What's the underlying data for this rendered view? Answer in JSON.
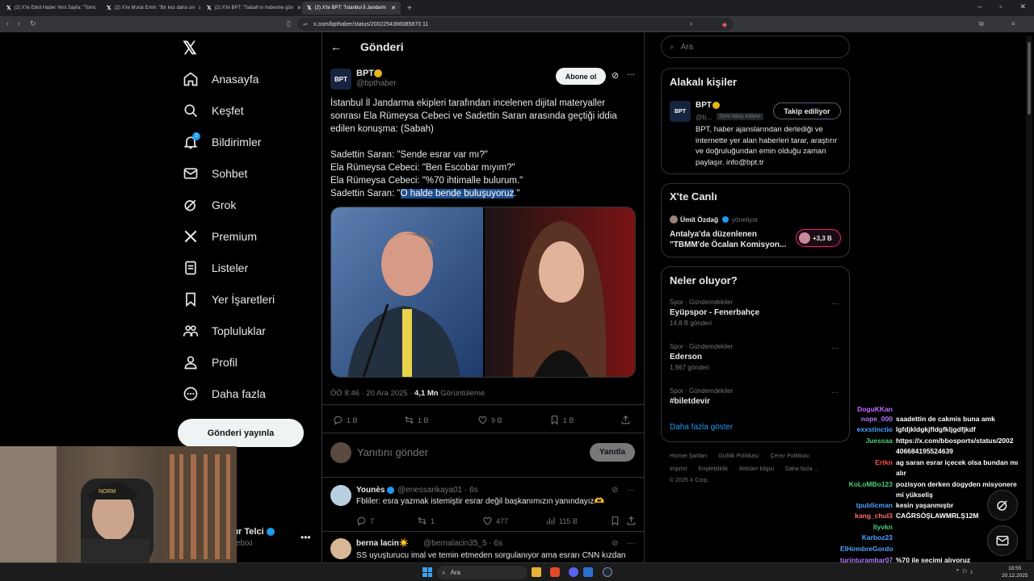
{
  "browser": {
    "tabs": [
      {
        "title": "(2) X'te Etkili Haber Yeni Sayfa: \"Tomc"
      },
      {
        "title": "(2) X'te Murat Emin: \"Bir kez daha sıv"
      },
      {
        "title": "(2) X'te BPT: \"Sabah'ın haberine görı"
      },
      {
        "title": "(2) X'te BPT: \"İstanbul İl Jandarm"
      }
    ],
    "url": "x.com/bpthaber/status/2002254366085870 11"
  },
  "nav": {
    "items": [
      {
        "label": "Anasayfa"
      },
      {
        "label": "Keşfet"
      },
      {
        "label": "Bildirimler"
      },
      {
        "label": "Sohbet"
      },
      {
        "label": "Grok"
      },
      {
        "label": "Premium"
      },
      {
        "label": "Listeler"
      },
      {
        "label": "Yer İşaretleri"
      },
      {
        "label": "Topluluklar"
      },
      {
        "label": "Profil"
      },
      {
        "label": "Daha fazla"
      }
    ],
    "notif_badge": "2",
    "post_button": "Gönderi yayınla",
    "profile_name_partial": "ır Telci",
    "profile_handle_partial": "ebixi"
  },
  "header": {
    "title": "Gönderi"
  },
  "tweet": {
    "name": "BPT",
    "handle": "@bpthaber",
    "subscribe": "Abone ol",
    "avatar_text": "BPT",
    "text1": "İstanbul İl Jandarma ekipleri tarafından incelenen dijital materyaller sonrası Ela Rümeysa Cebeci ve Sadettin Saran arasında geçtiği iddia edilen konuşma: (Sabah)",
    "line1": "Sadettin Saran: \"Sende esrar var mı?\"",
    "line2": "Ela Rümeysa Cebeci: \"Ben Escobar mıyım?\"",
    "line3": "Ela Rümeysa Cebeci: \"%70 ihtimalle bulurum.\"",
    "line4_prefix": "Sadettin Saran: \"",
    "line4_highlight": "O halde bende buluşuyoruz",
    "line4_suffix": ".\"",
    "meta_time": "ÖÖ 8:46 · 20 Ara 2025 · ",
    "meta_views": "4,1 Mn",
    "meta_views_label": " Görüntüleme",
    "replies": "1 B",
    "retweets": "1 B",
    "likes": "9 B",
    "bookmarks": "1 B"
  },
  "reply_box": {
    "placeholder": "Yanıtını gönder",
    "button": "Yanıtla"
  },
  "replies": [
    {
      "name": "Younès",
      "handle": "@enessarikaya01 · 6s",
      "text": "Fbliler: esra yazmak istemiştir esrar değil başkanımızın yanındayız🫶",
      "replies": "7",
      "retweets": "1",
      "likes": "477",
      "views": "115 B"
    },
    {
      "name": "berna lacin☀️",
      "handle": "@bernalacin35_5 · 6s",
      "text": "SS uyuşturucu imal ve temin etmeden sorgulanıyor ama esrarı CNN kızdan"
    }
  ],
  "search": {
    "placeholder": "Ara"
  },
  "related": {
    "title": "Alakalı kişiler",
    "name": "BPT",
    "handle": "@b...",
    "follows_you": "Seni takip ediyor",
    "button": "Takip ediliyor",
    "bio": "BPT, haber ajanslarından derlediği ve internette yer alan haberleri tarar, araştırır ve doğruluğundan emin olduğu zaman paylaşır. info@bpt.tr"
  },
  "live": {
    "title": "X'te Canlı",
    "host": "Ümit Özdağ",
    "role": "yönetiyor",
    "text": "Antalya'da düzenlenen \"TBMM'de Öcalan Komisyon...",
    "count": "+3,3 B"
  },
  "trends": {
    "title": "Neler oluyor?",
    "items": [
      {
        "meta": "Spor · Gündemdekiler",
        "title": "Eyüpspor - Fenerbahçe",
        "count": "14,8 B gönderi"
      },
      {
        "meta": "Spor · Gündemdekiler",
        "title": "Ederson",
        "count": "1.967 gönderi"
      },
      {
        "meta": "Spor · Gündemdekiler",
        "title": "#biletdevir",
        "count": ""
      }
    ],
    "more": "Daha fazla göster"
  },
  "footer": {
    "links1": [
      "Hizmet Şartları",
      "Gizlilik Politikası",
      "Çerez Politikası"
    ],
    "links2": [
      "Imprint",
      "Erişilebilirlik",
      "Reklam bilgisi",
      "Daha fazla ..."
    ],
    "copyright": "© 2025 X Corp."
  },
  "chat": [
    {
      "user": "DoguKKan",
      "msg": "",
      "color": "#c86bff"
    },
    {
      "user": "nope_000",
      "msg": "saadettin de cakmis buna amk",
      "color": "#b07cff"
    },
    {
      "user": "exxstinctio",
      "msg": "lgfdjkldgkjfldgfkljgdfjkdf",
      "color": "#4da3ff"
    },
    {
      "user": "Juessaa",
      "msg": "https://x.com/bbosports/status/2002",
      "color": "#4dd07a"
    },
    {
      "user": "",
      "msg": "406684195524639",
      "color": "#4dd07a"
    },
    {
      "user": "Ertkn",
      "msg": "ag saran esrar içecek olsa bundan mı",
      "color": "#ff5050"
    },
    {
      "user": "",
      "msg": "alır",
      "color": "#ff5050"
    },
    {
      "user": "KoLoMBo123",
      "msg": "pozisyon derken dogyden misyonere",
      "color": "#4dd07a"
    },
    {
      "user": "",
      "msg": "mi yükseliş",
      "color": "#4dd07a"
    },
    {
      "user": "tpublicman",
      "msg": "kesin yaşanmıştır",
      "color": "#4da3ff"
    },
    {
      "user": "kang_chul3",
      "msg": "CAĞRSÖŞLAWMRLŞ12M",
      "color": "#ff7070"
    },
    {
      "user": "llyvkn",
      "msg": "",
      "color": "#4dd07a"
    },
    {
      "user": "Karboz23",
      "msg": "",
      "color": "#4da3ff"
    },
    {
      "user": "ElHombreGordo",
      "msg": "",
      "color": "#4da3ff"
    },
    {
      "user": "turinturambar07",
      "msg": "%70 ile seçimi alıyoruz",
      "color": "#b07cff"
    },
    {
      "user": "DoguKKan",
      "msg": "",
      "color": "#c86bff"
    }
  ],
  "taskbar": {
    "search": "Ara",
    "time": "18:55",
    "date": "20.12.2025"
  },
  "colors": {
    "bg": "#000000",
    "border": "#2f3336",
    "accent": "#1d9bf0",
    "text": "#e7e9ea",
    "muted": "#71767b"
  }
}
